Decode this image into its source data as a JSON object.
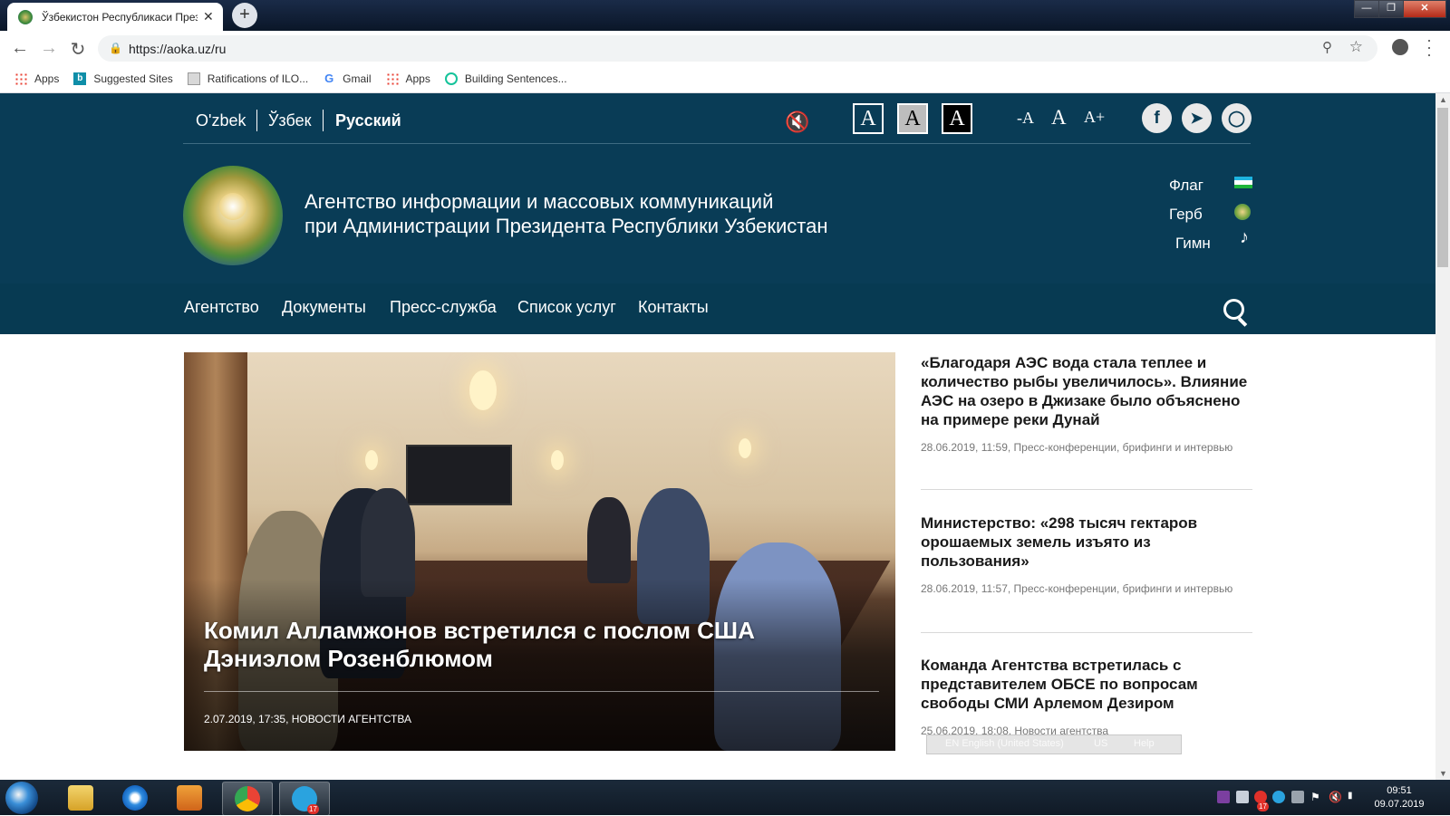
{
  "browser": {
    "tab_title": "Ўзбекистон Республикаси Президенти",
    "tab_close": "✕",
    "new_tab": "+",
    "url": "https://aoka.uz/ru",
    "bookmarks": [
      {
        "label": "Apps",
        "icon": "apps-grid-icon"
      },
      {
        "label": "Suggested Sites",
        "icon": "bing-icon"
      },
      {
        "label": "Ratifications of ILO...",
        "icon": "document-icon"
      },
      {
        "label": "Gmail",
        "icon": "google-icon"
      },
      {
        "label": "Apps",
        "icon": "apps-grid-icon"
      },
      {
        "label": "Building Sentences...",
        "icon": "grammarly-icon"
      }
    ]
  },
  "site": {
    "languages": [
      {
        "label": "O'zbek",
        "active": false
      },
      {
        "label": "Ўзбек",
        "active": false
      },
      {
        "label": "Русский",
        "active": true
      }
    ],
    "contrast_letter": "A",
    "font_size": {
      "decrease": "-A",
      "normal": "A",
      "increase": "A+"
    },
    "social_icons": [
      "facebook-icon",
      "telegram-icon",
      "instagram-icon"
    ],
    "org_name_line1": "Агентство информации и массовых коммуникаций",
    "org_name_line2": "при Администрации Президента Республики Узбекистан",
    "symbols": [
      {
        "label": "Флаг",
        "icon": "flag-icon"
      },
      {
        "label": "Герб",
        "icon": "emblem-icon"
      },
      {
        "label": "Гимн",
        "icon": "music-note-icon"
      }
    ],
    "nav": [
      "Агентство",
      "Документы",
      "Пресс-служба",
      "Список услуг",
      "Контакты"
    ]
  },
  "hero": {
    "title": "Комил Алламжонов встретился с послом США Дэниэлом Розенблюмом",
    "meta": "2.07.2019, 17:35, НОВОСТИ АГЕНТСТВА"
  },
  "news": [
    {
      "title": "«Благодаря АЭС вода стала теплее и количество рыбы увеличилось». Влияние АЭС на озеро в Джизаке было объяснено на примере реки Дунай",
      "meta": "28.06.2019, 11:59, Пресс-конференции, брифинги и интервью"
    },
    {
      "title": "Министерство: «298 тысяч гектаров орошаемых земель изъято из пользования»",
      "meta": "28.06.2019, 11:57, Пресс-конференции, брифинги и интервью"
    },
    {
      "title": "Команда Агентства встретилась с представителем ОБСЕ по вопросам свободы СМИ Арлемом Дезиром",
      "meta": "25.06.2019, 18:08, Новости агентства"
    }
  ],
  "ime_bar": {
    "lang": "EN English (United States)",
    "layout": "US",
    "help": "Help"
  },
  "taskbar": {
    "clock_time": "09:51",
    "clock_date": "09.07.2019",
    "telegram_badge": "17",
    "tray_badge": "17"
  },
  "colors": {
    "header_bg": "#093c56",
    "nav_bg": "#073a52",
    "accent_white": "#ffffff"
  }
}
